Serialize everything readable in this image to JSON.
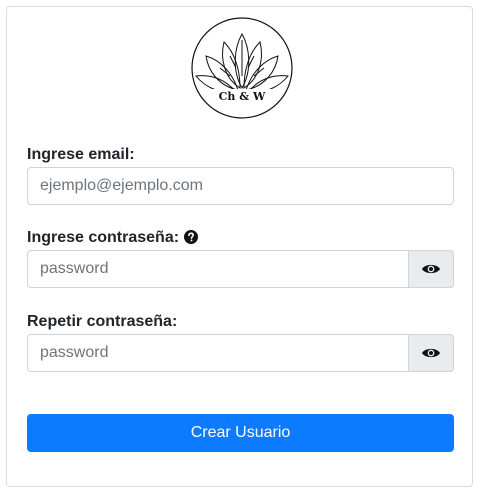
{
  "logo": {
    "text": "Ch & W"
  },
  "form": {
    "email_label": "Ingrese email:",
    "email_placeholder": "ejemplo@ejemplo.com",
    "password_label": "Ingrese contraseña:",
    "password_placeholder": "password",
    "repeat_label": "Repetir contraseña:",
    "repeat_placeholder": "password",
    "submit_label": "Crear Usuario"
  },
  "icons": {
    "help": "question-circle-icon",
    "toggle_visibility": "eye-icon"
  },
  "colors": {
    "primary": "#0d7bff",
    "addon_bg": "#e9ecef",
    "border": "#ced4da"
  }
}
